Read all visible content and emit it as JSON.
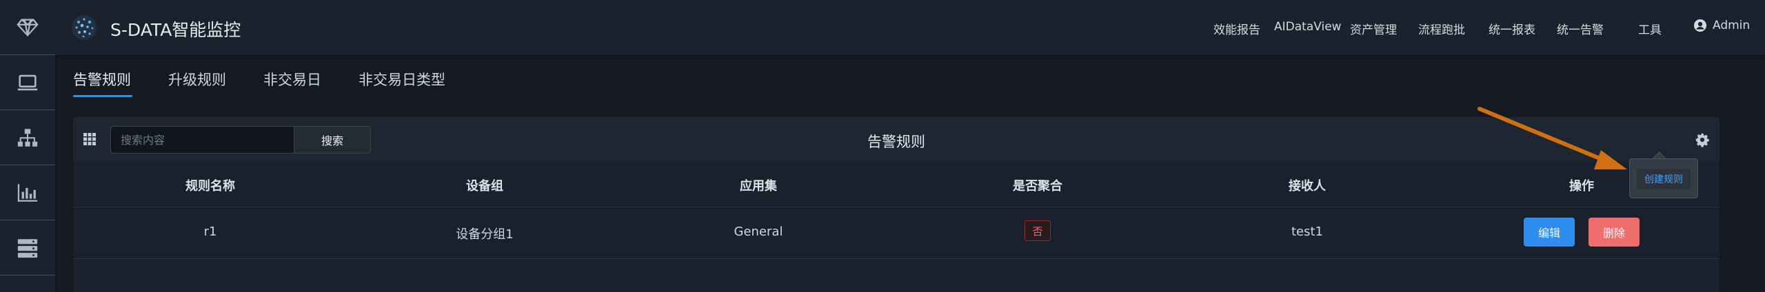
{
  "app": {
    "title": "S-DATA智能监控"
  },
  "rail": {
    "items": [
      {
        "icon": "diamond-icon"
      },
      {
        "icon": "laptop-icon"
      },
      {
        "icon": "sitemap-icon"
      },
      {
        "icon": "bar-chart-icon"
      },
      {
        "icon": "server-icon"
      }
    ]
  },
  "topnav": {
    "items": [
      {
        "label": "效能报告"
      },
      {
        "label": "AIDataView"
      },
      {
        "label": "资产管理"
      },
      {
        "label": "流程跑批"
      },
      {
        "label": "统一报表"
      },
      {
        "label": "统一告警"
      },
      {
        "label": "工具"
      }
    ],
    "user": {
      "label": "Admin",
      "icon": "user-circle-icon"
    }
  },
  "tabs": [
    {
      "label": "告警规则",
      "active": true
    },
    {
      "label": "升级规则",
      "active": false
    },
    {
      "label": "非交易日",
      "active": false
    },
    {
      "label": "非交易日类型",
      "active": false
    }
  ],
  "panel": {
    "title": "告警规则",
    "search": {
      "placeholder": "搜索内容",
      "value": "",
      "button_label": "搜索"
    },
    "settings_menu": {
      "items": [
        {
          "label": "创建规则"
        }
      ]
    }
  },
  "table": {
    "headers": [
      "规则名称",
      "设备组",
      "应用集",
      "是否聚合",
      "接收人",
      "操作"
    ],
    "rows": [
      {
        "name": "r1",
        "device_group": "设备分组1",
        "app_set": "General",
        "aggregate": "否",
        "receiver": "test1",
        "actions": {
          "edit": "编辑",
          "delete": "删除"
        }
      }
    ]
  },
  "colors": {
    "accent": "#3f8fcf",
    "edit_button": "#2f8df0",
    "delete_button": "#ee6e6e",
    "annotation_arrow": "#d07012"
  }
}
